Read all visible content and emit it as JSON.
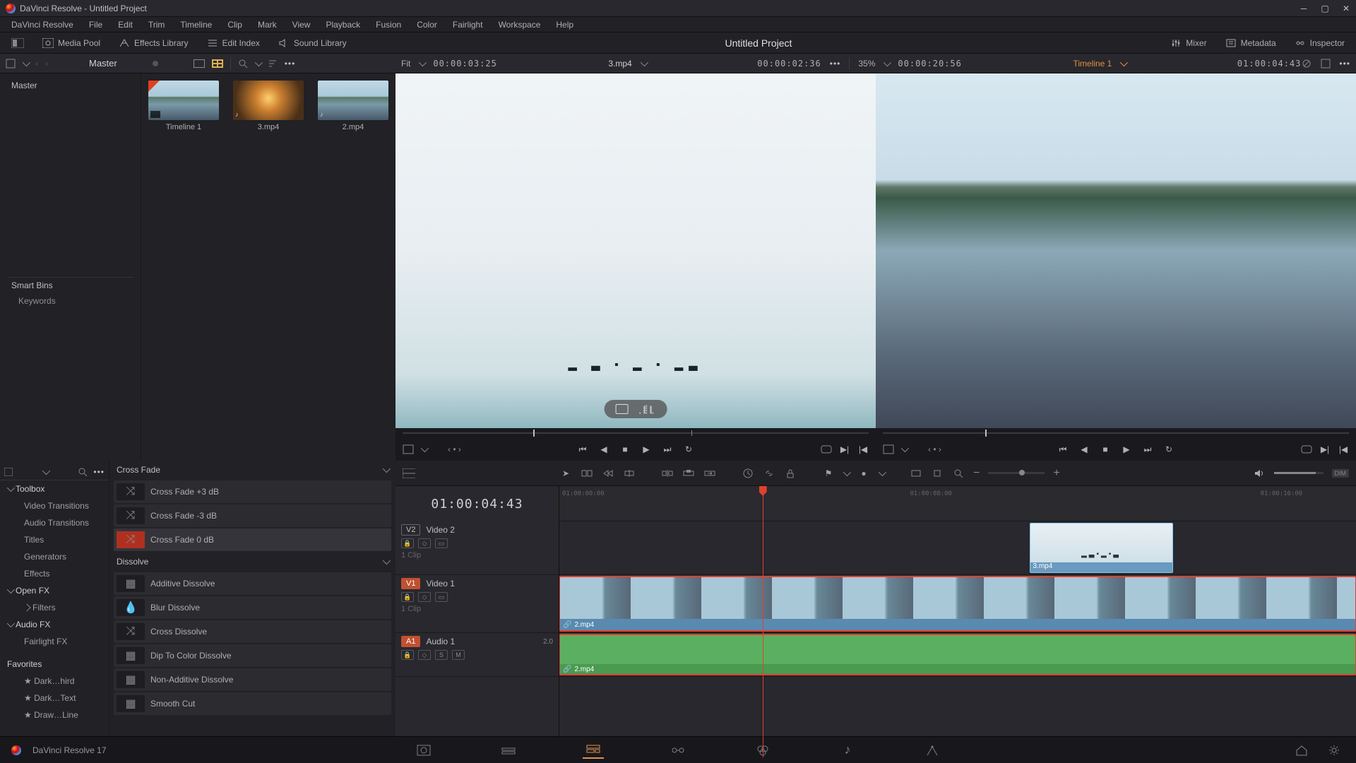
{
  "window": {
    "title": "DaVinci Resolve - Untitled Project"
  },
  "menubar": [
    "DaVinci Resolve",
    "File",
    "Edit",
    "Trim",
    "Timeline",
    "Clip",
    "Mark",
    "View",
    "Playback",
    "Fusion",
    "Color",
    "Fairlight",
    "Workspace",
    "Help"
  ],
  "toolbar": {
    "media_pool": "Media Pool",
    "effects_library": "Effects Library",
    "edit_index": "Edit Index",
    "sound_library": "Sound Library",
    "center_title": "Untitled Project",
    "mixer": "Mixer",
    "metadata": "Metadata",
    "inspector": "Inspector"
  },
  "subtoolbar": {
    "master": "Master",
    "fit": "Fit",
    "source_tc": "00:00:03:25",
    "source_name": "3.mp4",
    "source_pos": "00:00:02:36",
    "zoom_pct": "35%",
    "program_tc": "00:00:20:56",
    "timeline_name": "Timeline 1",
    "timeline_tc": "01:00:04:43"
  },
  "bins": {
    "root": "Master",
    "smart_bins": "Smart Bins",
    "keywords": "Keywords",
    "clips": [
      {
        "name": "Timeline 1",
        "kind": "timeline"
      },
      {
        "name": "3.mp4",
        "kind": "av-tunnel"
      },
      {
        "name": "2.mp4",
        "kind": "av-lake"
      }
    ]
  },
  "fx": {
    "toolbox": "Toolbox",
    "video_transitions": "Video Transitions",
    "audio_transitions": "Audio Transitions",
    "titles": "Titles",
    "generators": "Generators",
    "effects": "Effects",
    "open_fx": "Open FX",
    "filters": "Filters",
    "audio_fx": "Audio FX",
    "fairlight_fx": "Fairlight FX",
    "favorites": "Favorites",
    "fav_items": [
      "Dark…hird",
      "Dark…Text",
      "Draw…Line"
    ],
    "cat_crossfade": "Cross Fade",
    "crossfade_items": [
      "Cross Fade +3 dB",
      "Cross Fade -3 dB",
      "Cross Fade 0 dB"
    ],
    "cat_dissolve": "Dissolve",
    "dissolve_items": [
      "Additive Dissolve",
      "Blur Dissolve",
      "Cross Dissolve",
      "Dip To Color Dissolve",
      "Non-Additive Dissolve",
      "Smooth Cut"
    ]
  },
  "timeline": {
    "tc_display": "01:00:04:43",
    "ruler_labels": [
      "01:00:00:00",
      "01:00:08:00",
      "01:00:16:00"
    ],
    "tracks": {
      "v2": {
        "badge": "V2",
        "name": "Video 2",
        "clips": "1 Clip"
      },
      "v1": {
        "badge": "V1",
        "name": "Video 1",
        "clips": "1 Clip"
      },
      "a1": {
        "badge": "A1",
        "name": "Audio 1",
        "ch": "2.0",
        "s": "S",
        "m": "M"
      }
    },
    "clips": {
      "v2_clip": "3.mp4",
      "v1_clip": "2.mp4",
      "a1_clip": "2.mp4"
    },
    "dim": "DIM"
  },
  "footer": {
    "version": "DaVinci Resolve 17"
  }
}
